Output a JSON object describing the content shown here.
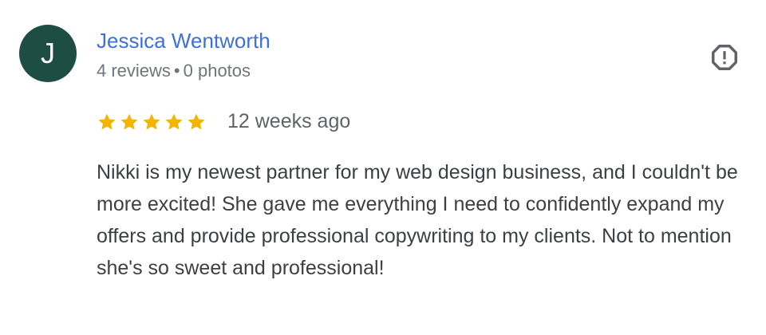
{
  "review": {
    "avatar_initial": "J",
    "avatar_color": "#1e4e43",
    "author_name": "Jessica Wentworth",
    "reviews_count": "4 reviews",
    "separator": "•",
    "photos_count": "0 photos",
    "report_icon": "report-flag-icon",
    "rating": 5,
    "rating_max": 5,
    "star_color": "#f4b400",
    "time_ago": "12 weeks ago",
    "text": "Nikki is my newest partner for my web design business, and I couldn't be more excited! She gave me everything I need to confidently expand my offers and provide professional copywriting to my clients. Not to mention she's so sweet and professional!"
  }
}
